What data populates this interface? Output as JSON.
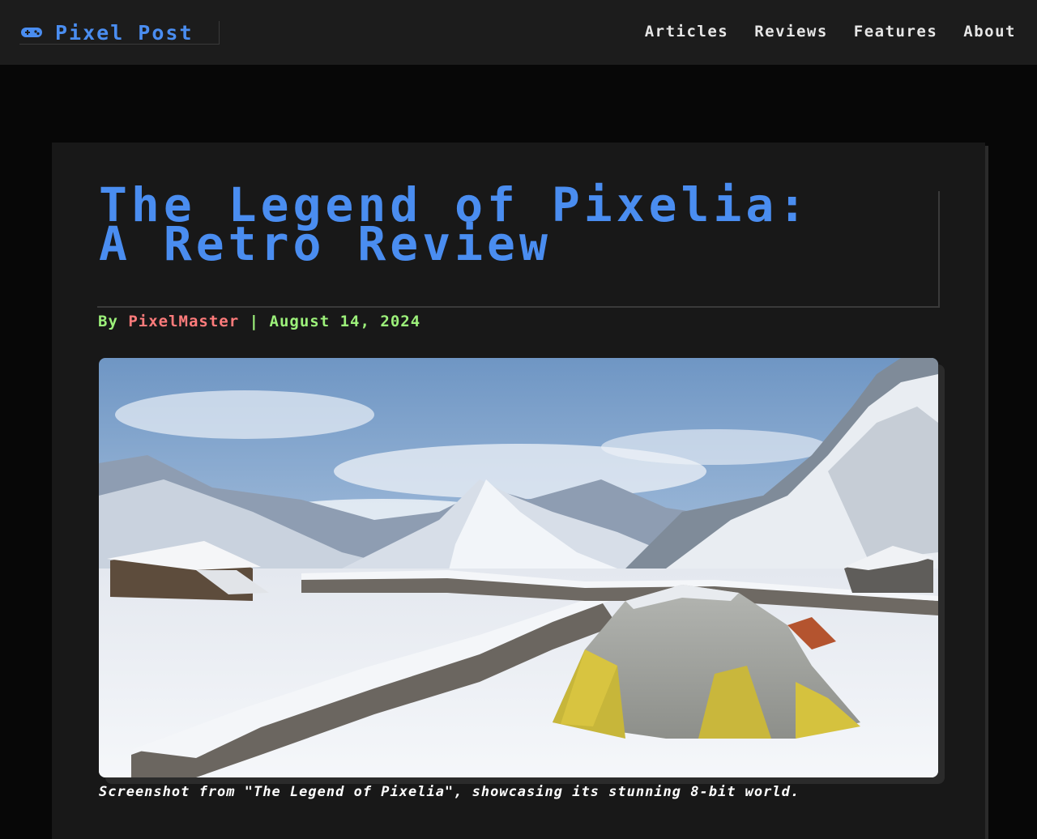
{
  "header": {
    "brand": "Pixel Post",
    "brand_icon": "gamepad-icon",
    "accent_color": "#4a8df0",
    "nav": [
      {
        "label": "Articles"
      },
      {
        "label": "Reviews"
      },
      {
        "label": "Features"
      },
      {
        "label": "About"
      }
    ]
  },
  "article": {
    "title": "The Legend of Pixelia: A Retro Review",
    "by_label": "By",
    "author": "PixelMaster",
    "separator": "|",
    "date": "August 14, 2024",
    "image_alt": "Snowy mountain camp with yellow tent",
    "caption": "Screenshot from \"The Legend of Pixelia\", showcasing its stunning 8-bit world.",
    "meta_color": "#9cf07a",
    "author_color": "#ff7b7b"
  }
}
